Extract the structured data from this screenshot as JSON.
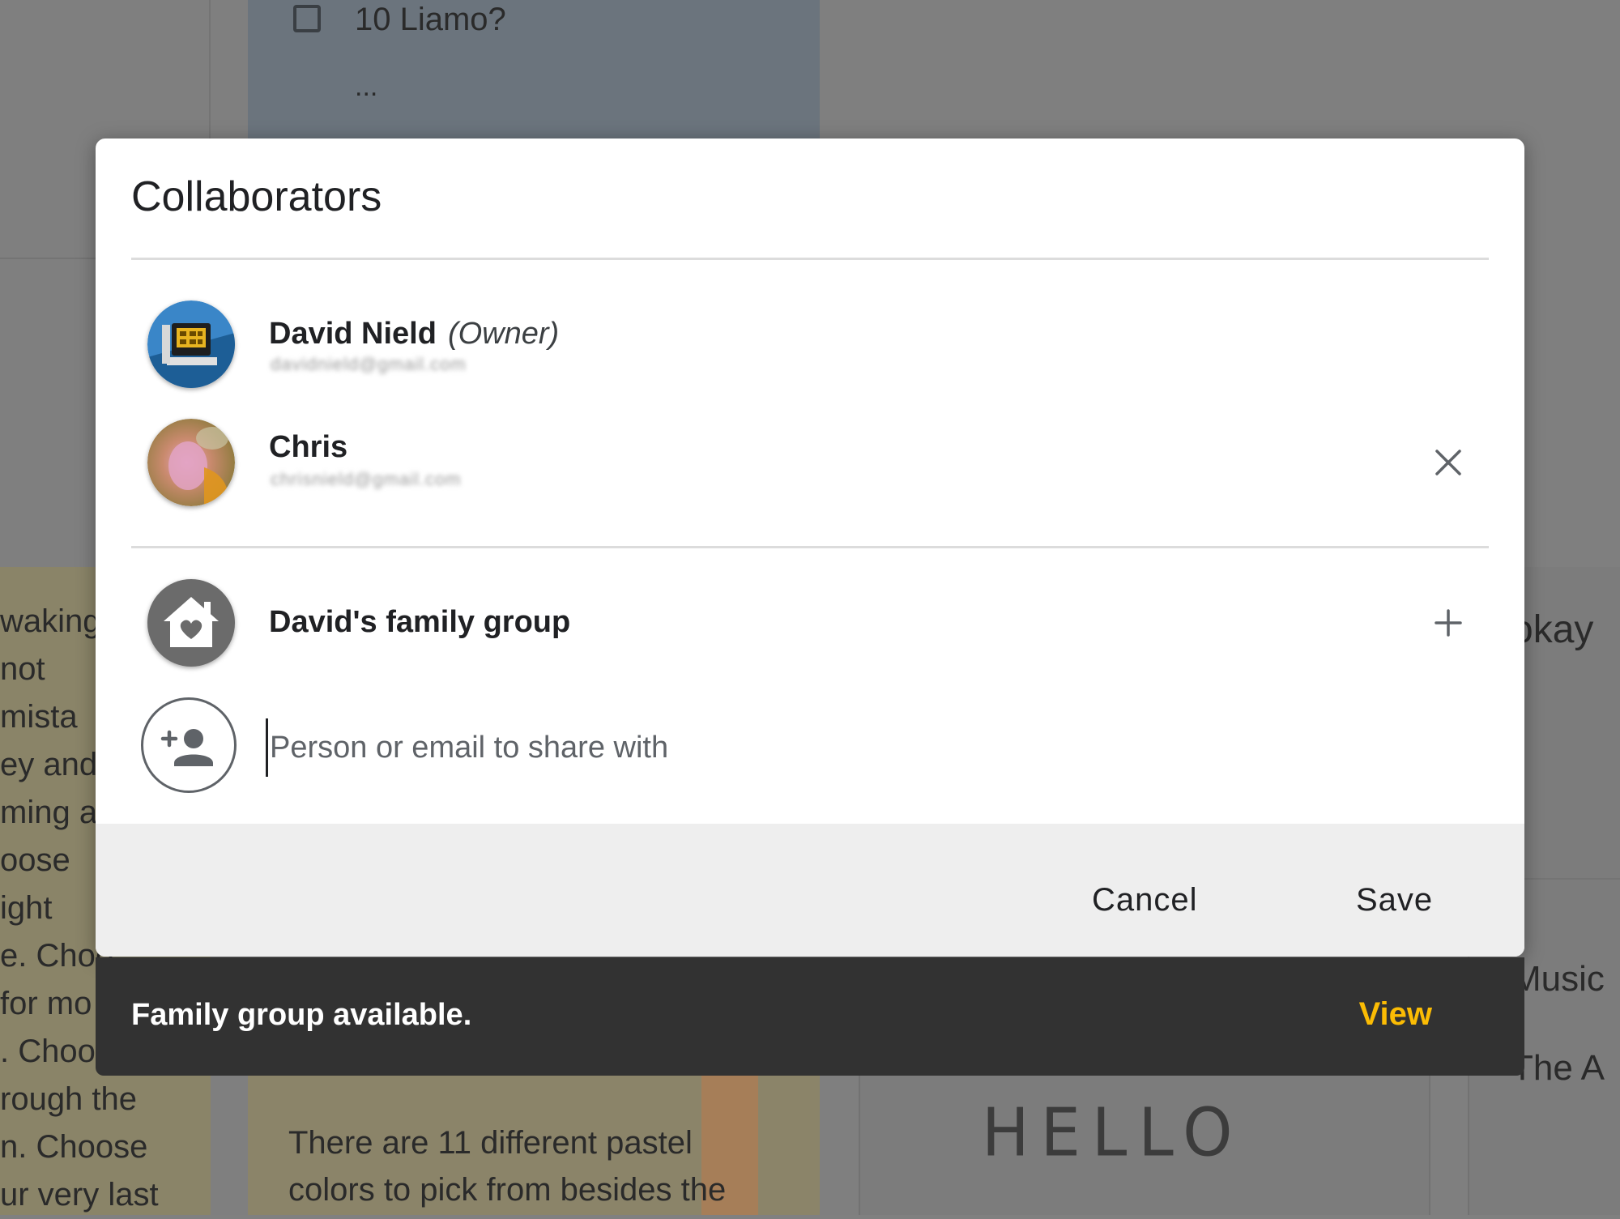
{
  "background": {
    "note_checkbox_text": "10 Liamo?",
    "note_ellipsis": "...",
    "left_note_fragments": [
      "waking",
      "not",
      " mista",
      "ey and",
      "ming a",
      "oose",
      "ight",
      "e. Choo",
      "for mo",
      ". Choo",
      "rough the",
      "n. Choose",
      "ur very last"
    ],
    "mid_note_lines": [
      "There are 11 different pastel",
      "colors to pick from besides the"
    ],
    "right_fragments": [
      "okay",
      "Music",
      "The A"
    ],
    "handwriting": "HELLO"
  },
  "dialog": {
    "title": "Collaborators",
    "collaborators": [
      {
        "name": "David Nield",
        "role": "(Owner)",
        "email": "davidnield@gmail.com",
        "removable": false
      },
      {
        "name": "Chris",
        "email": "chrisnield@gmail.com",
        "removable": true
      }
    ],
    "family_group": {
      "label": "David's family group"
    },
    "share_input": {
      "placeholder": "Person or email to share with",
      "value": ""
    },
    "cancel_label": "Cancel",
    "save_label": "Save"
  },
  "snackbar": {
    "message": "Family group available.",
    "action_label": "View"
  },
  "colors": {
    "snackbar_action": "#fbbc04",
    "snackbar_bg": "#323232",
    "footer_bg": "#eeeeee"
  },
  "icons": [
    "monitor-avatar-icon",
    "photo-avatar-icon",
    "close-icon",
    "family-home-icon",
    "add-icon",
    "person-add-icon"
  ]
}
